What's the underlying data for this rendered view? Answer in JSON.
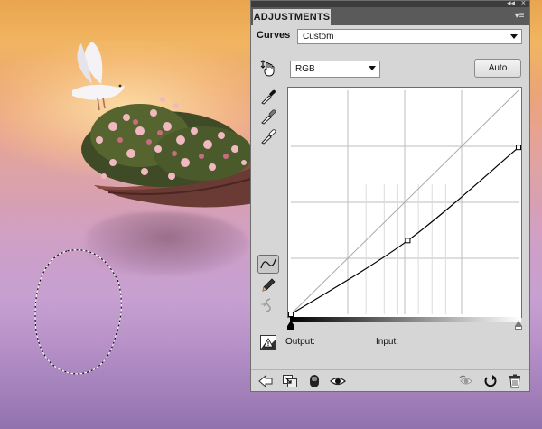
{
  "panel": {
    "tab_label": "ADJUSTMENTS",
    "collapse_glyph": "◂◂",
    "close_glyph": "×",
    "menu_glyph": "▾≡",
    "preset_label": "Curves",
    "preset_value": "Custom",
    "channel_value": "RGB",
    "auto_label": "Auto",
    "output_label": "Output:",
    "input_label": "Input:"
  },
  "curve": {
    "channel": "RGB",
    "range": [
      0,
      255
    ],
    "points": [
      [
        0,
        0
      ],
      [
        131,
        84
      ],
      [
        255,
        190
      ]
    ]
  },
  "icons": {
    "sidebar": [
      "on-image-adjust-icon",
      "eyedropper-black-icon",
      "eyedropper-gray-icon",
      "eyedropper-white-icon",
      "curve-smooth-icon",
      "pencil-icon",
      "smooth-curve-icon",
      "clipping-warning-icon"
    ],
    "footer": [
      "back-arrow-icon",
      "clip-to-layer-icon",
      "visibility-toggle-icon",
      "eye-icon",
      "view-previous-icon",
      "reset-icon",
      "trash-icon"
    ]
  }
}
